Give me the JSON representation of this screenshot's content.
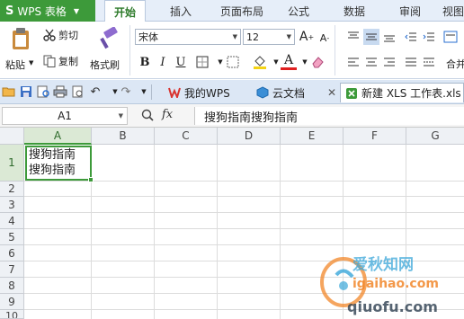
{
  "app": {
    "name": "WPS 表格",
    "logo_letter": "S"
  },
  "menu": {
    "tabs": [
      "开始",
      "插入",
      "页面布局",
      "公式",
      "数据",
      "审阅",
      "视图"
    ],
    "active": "开始"
  },
  "ribbon": {
    "paste_label": "粘贴",
    "cut_label": "剪切",
    "copy_label": "复制",
    "format_painter_label": "格式刷",
    "font_name": "宋体",
    "font_size": "12",
    "bold": "B",
    "italic": "I",
    "underline": "U",
    "grow": "A",
    "shrink": "A",
    "font_color_letter": "A",
    "merge_label": "合并"
  },
  "doc_tabs": [
    {
      "label": "我的WPS",
      "icon": "wps-icon"
    },
    {
      "label": "云文档",
      "icon": "cloud-doc-icon"
    },
    {
      "label": "新建 XLS 工作表.xls *",
      "icon": "spreadsheet-icon",
      "active": true
    }
  ],
  "formula_bar": {
    "cell_ref": "A1",
    "fx": "fx",
    "content": "搜狗指南搜狗指南"
  },
  "sheet": {
    "columns": [
      "A",
      "B",
      "C",
      "D",
      "E",
      "F",
      "G"
    ],
    "rows": [
      "1",
      "2",
      "3",
      "4",
      "5",
      "6",
      "7",
      "8",
      "9",
      "10"
    ],
    "selected_col": "A",
    "selected_row": "1",
    "cells": {
      "A1": [
        "搜狗指南",
        "搜狗指南"
      ]
    }
  },
  "watermark": {
    "line1": "爱秋知网",
    "line2": "igaihao.com",
    "line3": "qiuofu.com"
  },
  "colors": {
    "accent": "#3d9a3a",
    "menubar": "#e6eef9",
    "header_bg": "#eef1f5"
  }
}
